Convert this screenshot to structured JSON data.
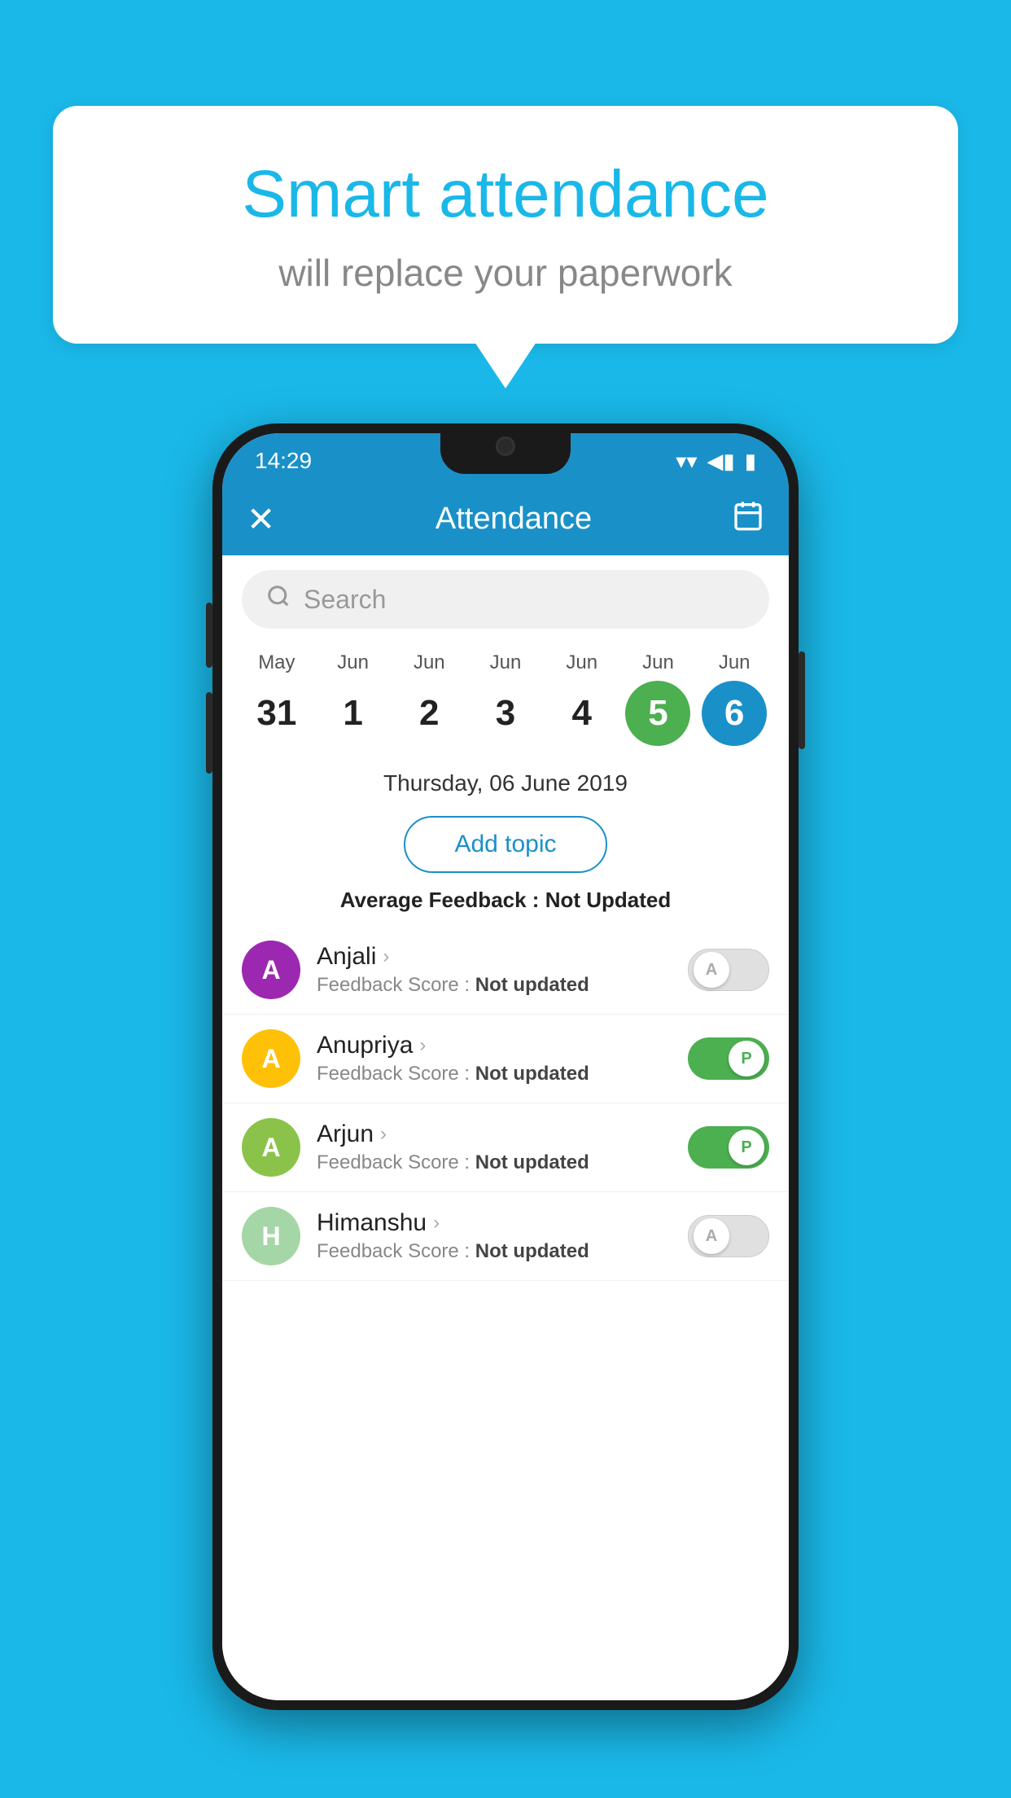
{
  "background_color": "#1ab8e8",
  "bubble": {
    "title": "Smart attendance",
    "subtitle": "will replace your paperwork"
  },
  "status_bar": {
    "time": "14:29",
    "wifi": "▼",
    "signal": "▲",
    "battery": "▮"
  },
  "header": {
    "close_label": "✕",
    "title": "Attendance",
    "calendar_icon": "📅"
  },
  "search": {
    "placeholder": "Search"
  },
  "dates": [
    {
      "month": "May",
      "day": "31",
      "state": "normal"
    },
    {
      "month": "Jun",
      "day": "1",
      "state": "normal"
    },
    {
      "month": "Jun",
      "day": "2",
      "state": "normal"
    },
    {
      "month": "Jun",
      "day": "3",
      "state": "normal"
    },
    {
      "month": "Jun",
      "day": "4",
      "state": "normal"
    },
    {
      "month": "Jun",
      "day": "5",
      "state": "today"
    },
    {
      "month": "Jun",
      "day": "6",
      "state": "selected"
    }
  ],
  "selected_date": "Thursday, 06 June 2019",
  "add_topic_label": "Add topic",
  "avg_feedback_label": "Average Feedback :",
  "avg_feedback_value": "Not Updated",
  "students": [
    {
      "name": "Anjali",
      "avatar_letter": "A",
      "avatar_color": "#9C27B0",
      "feedback_label": "Feedback Score :",
      "feedback_value": "Not updated",
      "toggle_state": "off",
      "toggle_letter": "A"
    },
    {
      "name": "Anupriya",
      "avatar_letter": "A",
      "avatar_color": "#FFC107",
      "feedback_label": "Feedback Score :",
      "feedback_value": "Not updated",
      "toggle_state": "on",
      "toggle_letter": "P"
    },
    {
      "name": "Arjun",
      "avatar_letter": "A",
      "avatar_color": "#8BC34A",
      "feedback_label": "Feedback Score :",
      "feedback_value": "Not updated",
      "toggle_state": "on",
      "toggle_letter": "P"
    },
    {
      "name": "Himanshu",
      "avatar_letter": "H",
      "avatar_color": "#A5D6A7",
      "feedback_label": "Feedback Score :",
      "feedback_value": "Not updated",
      "toggle_state": "off",
      "toggle_letter": "A"
    }
  ]
}
